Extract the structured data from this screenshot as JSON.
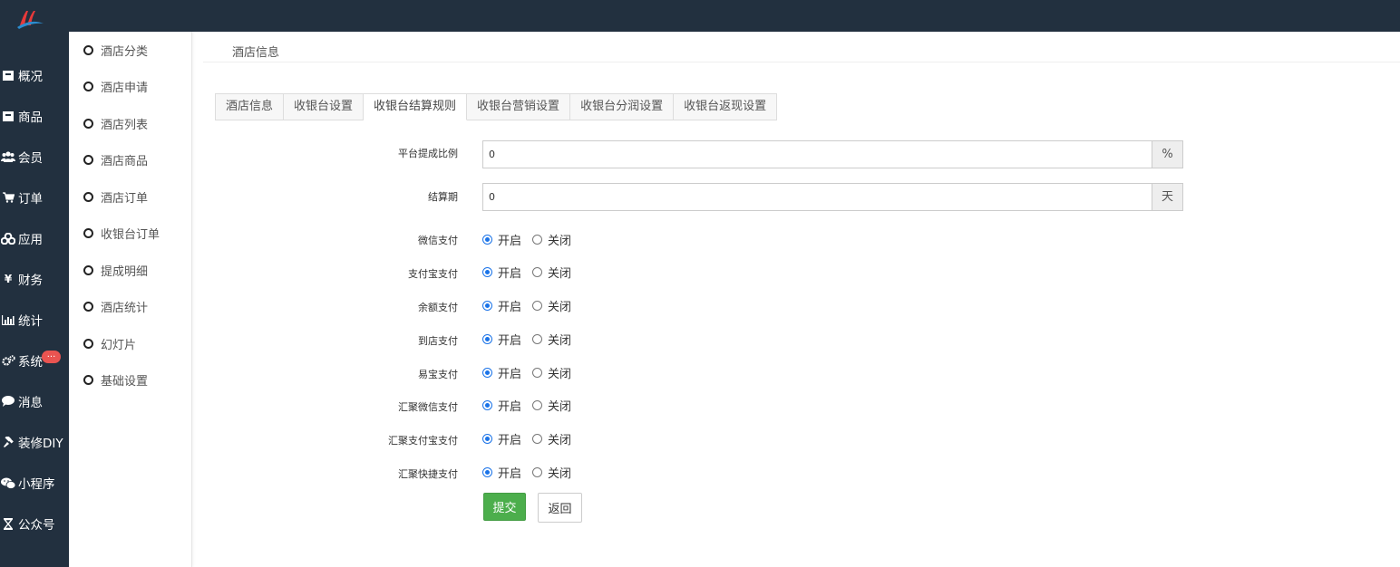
{
  "colors": {
    "topbar": "#22303f",
    "accent": "#1a73e8",
    "submit": "#4cae4c",
    "badge": "#e95451"
  },
  "sidebar": {
    "items": [
      {
        "label": "概况",
        "icon": "inbox-icon"
      },
      {
        "label": "商品",
        "icon": "archive-icon"
      },
      {
        "label": "会员",
        "icon": "users-icon"
      },
      {
        "label": "订单",
        "icon": "cart-icon"
      },
      {
        "label": "应用",
        "icon": "cubes-icon"
      },
      {
        "label": "财务",
        "icon": "yen-icon"
      },
      {
        "label": "统计",
        "icon": "bar-chart-icon"
      },
      {
        "label": "系统",
        "icon": "gears-icon"
      },
      {
        "label": "消息",
        "icon": "comment-icon"
      },
      {
        "label": "装修DIY",
        "icon": "gavel-icon"
      },
      {
        "label": "小程序",
        "icon": "wechat-icon"
      },
      {
        "label": "公众号",
        "icon": "hourglass-icon"
      }
    ],
    "badge": "..."
  },
  "subnav": {
    "items": [
      "酒店分类",
      "酒店申请",
      "酒店列表",
      "酒店商品",
      "酒店订单",
      "收银台订单",
      "提成明细",
      "酒店统计",
      "幻灯片",
      "基础设置"
    ]
  },
  "page": {
    "title": "酒店信息"
  },
  "tabs": [
    "酒店信息",
    "收银台设置",
    "收银台结算规则",
    "收银台营销设置",
    "收银台分润设置",
    "收银台返现设置"
  ],
  "form": {
    "commission": {
      "label": "平台提成比例",
      "value": "0",
      "unit": "%"
    },
    "settlement": {
      "label": "结算期",
      "value": "0",
      "unit": "天"
    },
    "on_label": "开启",
    "off_label": "关闭",
    "payments": [
      {
        "label": "微信支付"
      },
      {
        "label": "支付宝支付"
      },
      {
        "label": "余额支付"
      },
      {
        "label": "到店支付"
      },
      {
        "label": "易宝支付"
      },
      {
        "label": "汇聚微信支付"
      },
      {
        "label": "汇聚支付宝支付"
      },
      {
        "label": "汇聚快捷支付"
      }
    ],
    "submit": "提交",
    "back": "返回"
  }
}
